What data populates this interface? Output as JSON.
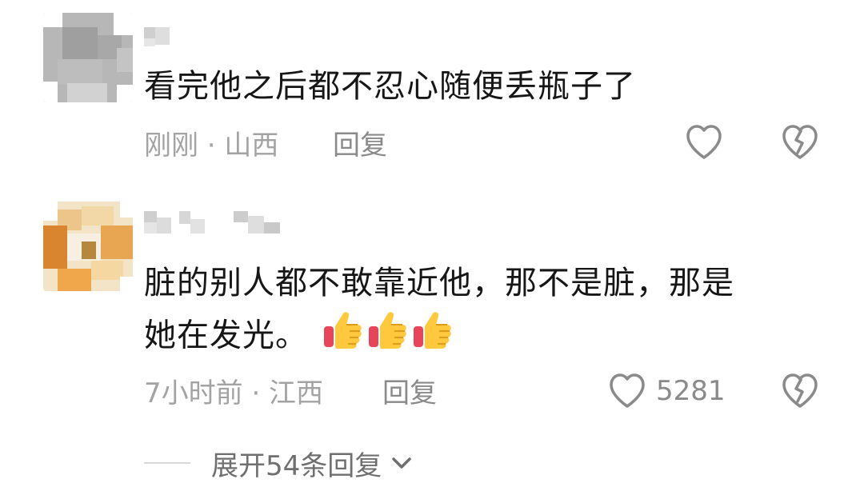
{
  "comments": [
    {
      "text": "看完他之后都不忍心随便丢瓶子了",
      "meta": "刚刚 · 山西",
      "reply_label": "回复",
      "like_count": "",
      "avatar_style": "pixelated-gray",
      "username_style": "pixelated"
    },
    {
      "text_line1": "脏的别人都不敢靠近他，那不是脏，那是",
      "text_line2": "她在发光。",
      "emojis": [
        "thumbs-up",
        "thumbs-up",
        "thumbs-up"
      ],
      "meta": "7小时前 · 江西",
      "reply_label": "回复",
      "like_count": "5281",
      "avatar_style": "pixelated-orange",
      "username_style": "pixelated"
    }
  ],
  "expand": {
    "label": "展开54条回复"
  },
  "colors": {
    "text": "#161616",
    "meta": "#a3a3a3",
    "action": "#8a8a8a",
    "divider": "#d9d9d9"
  },
  "icons": {
    "like": "heart-outline-icon",
    "dislike": "broken-heart-icon",
    "expand": "chevron-down-icon"
  }
}
